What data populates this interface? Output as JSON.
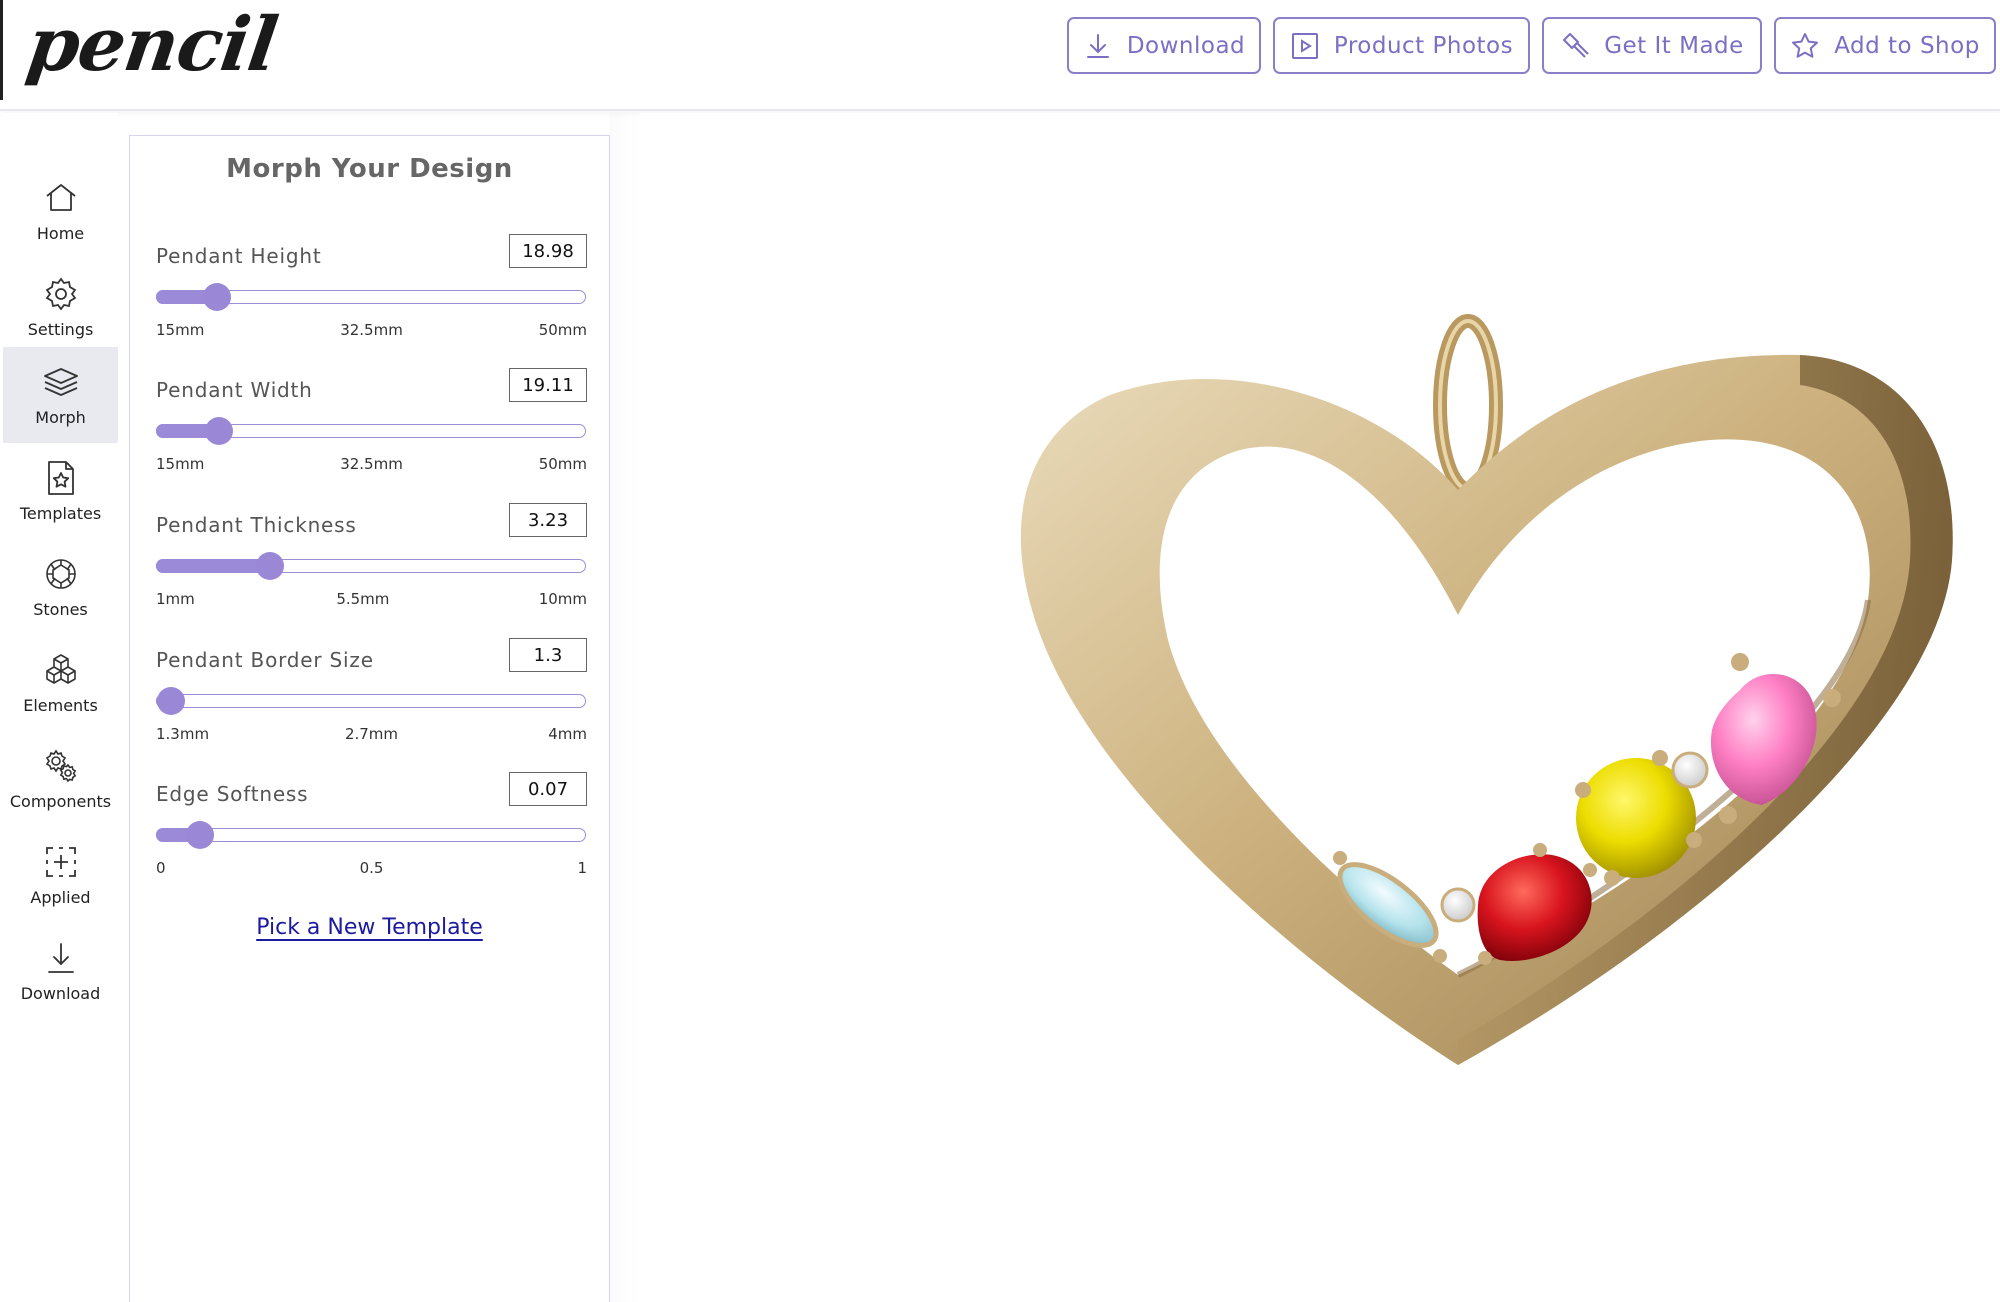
{
  "app": {
    "logo": "pencil"
  },
  "header": {
    "buttons": [
      {
        "label": "Download",
        "icon": "download-icon"
      },
      {
        "label": "Product Photos",
        "icon": "play-icon"
      },
      {
        "label": "Get It Made",
        "icon": "hammer-icon"
      },
      {
        "label": "Add to Shop",
        "icon": "star-icon"
      }
    ]
  },
  "nav": {
    "items": [
      {
        "label": "Home",
        "icon": "home-icon",
        "active": false
      },
      {
        "label": "Settings",
        "icon": "gear-icon",
        "active": false
      },
      {
        "label": "Morph",
        "icon": "layers-icon",
        "active": true
      },
      {
        "label": "Templates",
        "icon": "template-icon",
        "active": false
      },
      {
        "label": "Stones",
        "icon": "gem-icon",
        "active": false
      },
      {
        "label": "Elements",
        "icon": "cubes-icon",
        "active": false
      },
      {
        "label": "Components",
        "icon": "gears-icon",
        "active": false
      },
      {
        "label": "Applied",
        "icon": "add-frame-icon",
        "active": false
      },
      {
        "label": "Download",
        "icon": "download-icon",
        "active": false
      }
    ]
  },
  "panel": {
    "title": "Morph Your Design",
    "controls": [
      {
        "label": "Pendant Height",
        "value": "18.98",
        "fraction": 0.14,
        "min": "15mm",
        "mid": "32.5mm",
        "max": "50mm"
      },
      {
        "label": "Pendant Width",
        "value": "19.11",
        "fraction": 0.145,
        "min": "15mm",
        "mid": "32.5mm",
        "max": "50mm"
      },
      {
        "label": "Pendant Thickness",
        "value": "3.23",
        "fraction": 0.265,
        "min": "1mm",
        "mid": "5.5mm",
        "max": "10mm"
      },
      {
        "label": "Pendant Border Size",
        "value": "1.3",
        "fraction": 0.03,
        "min": "1.3mm",
        "mid": "2.7mm",
        "max": "4mm"
      },
      {
        "label": "Edge Softness",
        "value": "0.07",
        "fraction": 0.1,
        "min": "0",
        "mid": "0.5",
        "max": "1"
      }
    ],
    "link": "Pick a New Template"
  },
  "colors": {
    "accent": "#8a7fc8",
    "slider": "#9a88d6",
    "link": "#1b1aa0",
    "gold": "#c9ad7c",
    "stones": [
      "#b5e3ec",
      "#e01b24",
      "#f2e600",
      "#ff7fc4",
      "#ffffff"
    ]
  }
}
